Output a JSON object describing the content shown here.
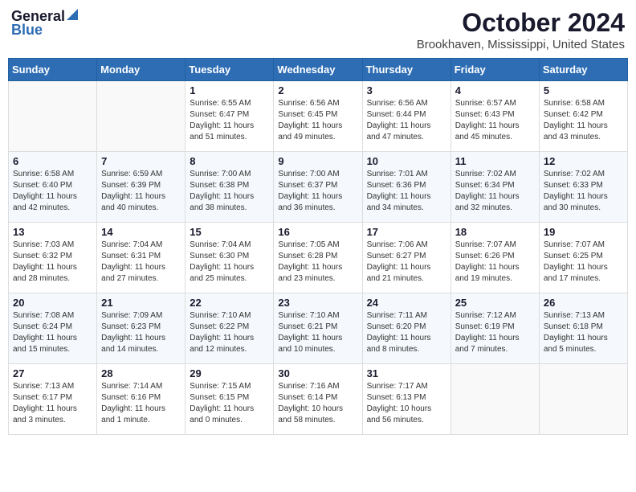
{
  "header": {
    "logo_general": "General",
    "logo_blue": "Blue",
    "month": "October 2024",
    "location": "Brookhaven, Mississippi, United States"
  },
  "weekdays": [
    "Sunday",
    "Monday",
    "Tuesday",
    "Wednesday",
    "Thursday",
    "Friday",
    "Saturday"
  ],
  "weeks": [
    [
      {
        "day": "",
        "sunrise": "",
        "sunset": "",
        "daylight": ""
      },
      {
        "day": "",
        "sunrise": "",
        "sunset": "",
        "daylight": ""
      },
      {
        "day": "1",
        "sunrise": "Sunrise: 6:55 AM",
        "sunset": "Sunset: 6:47 PM",
        "daylight": "Daylight: 11 hours and 51 minutes."
      },
      {
        "day": "2",
        "sunrise": "Sunrise: 6:56 AM",
        "sunset": "Sunset: 6:45 PM",
        "daylight": "Daylight: 11 hours and 49 minutes."
      },
      {
        "day": "3",
        "sunrise": "Sunrise: 6:56 AM",
        "sunset": "Sunset: 6:44 PM",
        "daylight": "Daylight: 11 hours and 47 minutes."
      },
      {
        "day": "4",
        "sunrise": "Sunrise: 6:57 AM",
        "sunset": "Sunset: 6:43 PM",
        "daylight": "Daylight: 11 hours and 45 minutes."
      },
      {
        "day": "5",
        "sunrise": "Sunrise: 6:58 AM",
        "sunset": "Sunset: 6:42 PM",
        "daylight": "Daylight: 11 hours and 43 minutes."
      }
    ],
    [
      {
        "day": "6",
        "sunrise": "Sunrise: 6:58 AM",
        "sunset": "Sunset: 6:40 PM",
        "daylight": "Daylight: 11 hours and 42 minutes."
      },
      {
        "day": "7",
        "sunrise": "Sunrise: 6:59 AM",
        "sunset": "Sunset: 6:39 PM",
        "daylight": "Daylight: 11 hours and 40 minutes."
      },
      {
        "day": "8",
        "sunrise": "Sunrise: 7:00 AM",
        "sunset": "Sunset: 6:38 PM",
        "daylight": "Daylight: 11 hours and 38 minutes."
      },
      {
        "day": "9",
        "sunrise": "Sunrise: 7:00 AM",
        "sunset": "Sunset: 6:37 PM",
        "daylight": "Daylight: 11 hours and 36 minutes."
      },
      {
        "day": "10",
        "sunrise": "Sunrise: 7:01 AM",
        "sunset": "Sunset: 6:36 PM",
        "daylight": "Daylight: 11 hours and 34 minutes."
      },
      {
        "day": "11",
        "sunrise": "Sunrise: 7:02 AM",
        "sunset": "Sunset: 6:34 PM",
        "daylight": "Daylight: 11 hours and 32 minutes."
      },
      {
        "day": "12",
        "sunrise": "Sunrise: 7:02 AM",
        "sunset": "Sunset: 6:33 PM",
        "daylight": "Daylight: 11 hours and 30 minutes."
      }
    ],
    [
      {
        "day": "13",
        "sunrise": "Sunrise: 7:03 AM",
        "sunset": "Sunset: 6:32 PM",
        "daylight": "Daylight: 11 hours and 28 minutes."
      },
      {
        "day": "14",
        "sunrise": "Sunrise: 7:04 AM",
        "sunset": "Sunset: 6:31 PM",
        "daylight": "Daylight: 11 hours and 27 minutes."
      },
      {
        "day": "15",
        "sunrise": "Sunrise: 7:04 AM",
        "sunset": "Sunset: 6:30 PM",
        "daylight": "Daylight: 11 hours and 25 minutes."
      },
      {
        "day": "16",
        "sunrise": "Sunrise: 7:05 AM",
        "sunset": "Sunset: 6:28 PM",
        "daylight": "Daylight: 11 hours and 23 minutes."
      },
      {
        "day": "17",
        "sunrise": "Sunrise: 7:06 AM",
        "sunset": "Sunset: 6:27 PM",
        "daylight": "Daylight: 11 hours and 21 minutes."
      },
      {
        "day": "18",
        "sunrise": "Sunrise: 7:07 AM",
        "sunset": "Sunset: 6:26 PM",
        "daylight": "Daylight: 11 hours and 19 minutes."
      },
      {
        "day": "19",
        "sunrise": "Sunrise: 7:07 AM",
        "sunset": "Sunset: 6:25 PM",
        "daylight": "Daylight: 11 hours and 17 minutes."
      }
    ],
    [
      {
        "day": "20",
        "sunrise": "Sunrise: 7:08 AM",
        "sunset": "Sunset: 6:24 PM",
        "daylight": "Daylight: 11 hours and 15 minutes."
      },
      {
        "day": "21",
        "sunrise": "Sunrise: 7:09 AM",
        "sunset": "Sunset: 6:23 PM",
        "daylight": "Daylight: 11 hours and 14 minutes."
      },
      {
        "day": "22",
        "sunrise": "Sunrise: 7:10 AM",
        "sunset": "Sunset: 6:22 PM",
        "daylight": "Daylight: 11 hours and 12 minutes."
      },
      {
        "day": "23",
        "sunrise": "Sunrise: 7:10 AM",
        "sunset": "Sunset: 6:21 PM",
        "daylight": "Daylight: 11 hours and 10 minutes."
      },
      {
        "day": "24",
        "sunrise": "Sunrise: 7:11 AM",
        "sunset": "Sunset: 6:20 PM",
        "daylight": "Daylight: 11 hours and 8 minutes."
      },
      {
        "day": "25",
        "sunrise": "Sunrise: 7:12 AM",
        "sunset": "Sunset: 6:19 PM",
        "daylight": "Daylight: 11 hours and 7 minutes."
      },
      {
        "day": "26",
        "sunrise": "Sunrise: 7:13 AM",
        "sunset": "Sunset: 6:18 PM",
        "daylight": "Daylight: 11 hours and 5 minutes."
      }
    ],
    [
      {
        "day": "27",
        "sunrise": "Sunrise: 7:13 AM",
        "sunset": "Sunset: 6:17 PM",
        "daylight": "Daylight: 11 hours and 3 minutes."
      },
      {
        "day": "28",
        "sunrise": "Sunrise: 7:14 AM",
        "sunset": "Sunset: 6:16 PM",
        "daylight": "Daylight: 11 hours and 1 minute."
      },
      {
        "day": "29",
        "sunrise": "Sunrise: 7:15 AM",
        "sunset": "Sunset: 6:15 PM",
        "daylight": "Daylight: 11 hours and 0 minutes."
      },
      {
        "day": "30",
        "sunrise": "Sunrise: 7:16 AM",
        "sunset": "Sunset: 6:14 PM",
        "daylight": "Daylight: 10 hours and 58 minutes."
      },
      {
        "day": "31",
        "sunrise": "Sunrise: 7:17 AM",
        "sunset": "Sunset: 6:13 PM",
        "daylight": "Daylight: 10 hours and 56 minutes."
      },
      {
        "day": "",
        "sunrise": "",
        "sunset": "",
        "daylight": ""
      },
      {
        "day": "",
        "sunrise": "",
        "sunset": "",
        "daylight": ""
      }
    ]
  ]
}
